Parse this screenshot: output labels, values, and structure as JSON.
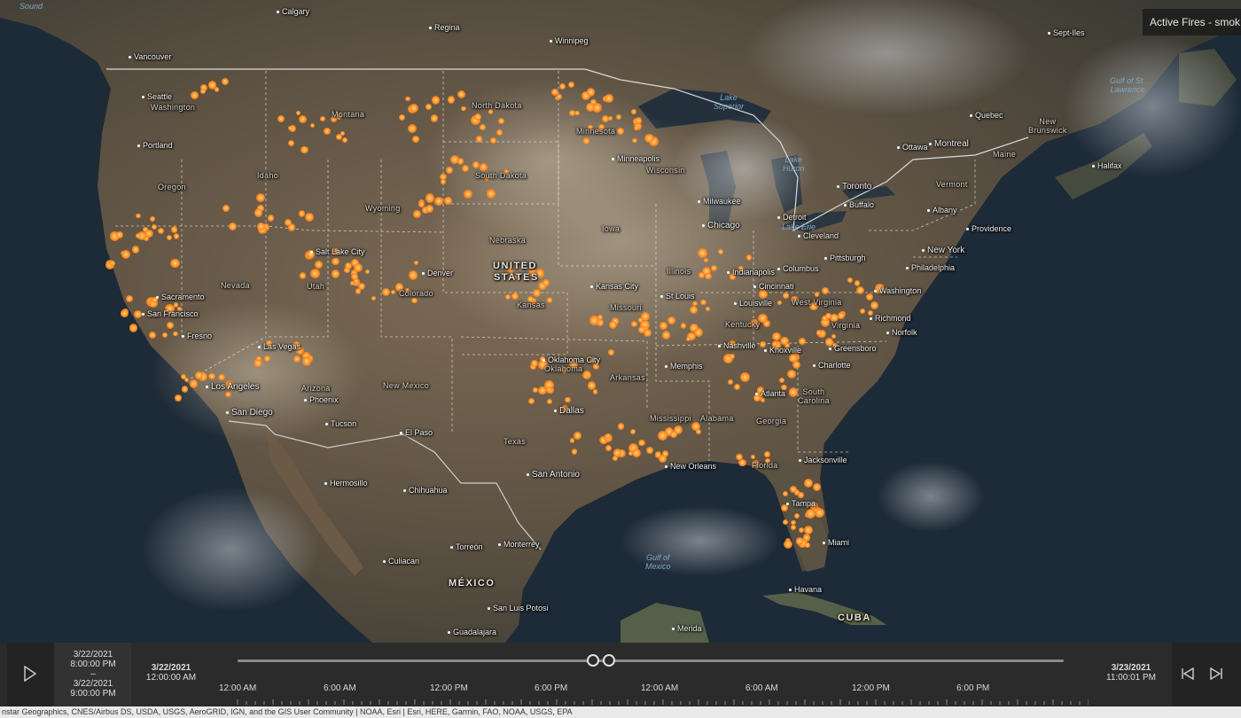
{
  "layer_title": "Active Fires - smok",
  "colors": {
    "fire": "#ff9a2e",
    "panel": "#2b2b2b",
    "ocean": "#1b2632"
  },
  "cities": [
    {
      "name": "Calgary",
      "big": false
    },
    {
      "name": "Regina",
      "big": false
    },
    {
      "name": "Winnipeg",
      "big": false
    },
    {
      "name": "Vancouver",
      "big": false
    },
    {
      "name": "Seattle",
      "big": false
    },
    {
      "name": "Portland",
      "big": false
    },
    {
      "name": "Sacramento",
      "big": false
    },
    {
      "name": "San Francisco",
      "big": false
    },
    {
      "name": "Fresno",
      "big": false
    },
    {
      "name": "Los Angeles",
      "big": true
    },
    {
      "name": "San Diego",
      "big": true
    },
    {
      "name": "Las Vegas",
      "big": false
    },
    {
      "name": "Phoenix",
      "big": false
    },
    {
      "name": "Tucson",
      "big": false
    },
    {
      "name": "Salt Lake City",
      "big": false
    },
    {
      "name": "Denver",
      "big": false
    },
    {
      "name": "El Paso",
      "big": false
    },
    {
      "name": "Hermosillo",
      "big": false
    },
    {
      "name": "Chihuahua",
      "big": false
    },
    {
      "name": "Culiacan",
      "big": false
    },
    {
      "name": "Torreón",
      "big": false
    },
    {
      "name": "Monterrey",
      "big": false
    },
    {
      "name": "San Luis Potosi",
      "big": false
    },
    {
      "name": "Guadalajara",
      "big": false
    },
    {
      "name": "Merida",
      "big": false
    },
    {
      "name": "Havana",
      "big": false
    },
    {
      "name": "Miami",
      "big": false
    },
    {
      "name": "Tampa",
      "big": false
    },
    {
      "name": "Jacksonville",
      "big": false
    },
    {
      "name": "Atlanta",
      "big": false
    },
    {
      "name": "Charlotte",
      "big": false
    },
    {
      "name": "Greensboro",
      "big": false
    },
    {
      "name": "Norfolk",
      "big": false
    },
    {
      "name": "Richmond",
      "big": false
    },
    {
      "name": "Washington",
      "big": false
    },
    {
      "name": "Philadelphia",
      "big": false
    },
    {
      "name": "New York",
      "big": true
    },
    {
      "name": "Providence",
      "big": false
    },
    {
      "name": "Albany",
      "big": false
    },
    {
      "name": "Pittsburgh",
      "big": false
    },
    {
      "name": "Columbus",
      "big": false
    },
    {
      "name": "Cleveland",
      "big": false
    },
    {
      "name": "Detroit",
      "big": false
    },
    {
      "name": "Buffalo",
      "big": false
    },
    {
      "name": "Toronto",
      "big": true
    },
    {
      "name": "Ottawa",
      "big": false
    },
    {
      "name": "Montreal",
      "big": true
    },
    {
      "name": "Quebec",
      "big": false
    },
    {
      "name": "Halifax",
      "big": false
    },
    {
      "name": "Sept-Iles",
      "big": false
    },
    {
      "name": "Chicago",
      "big": true
    },
    {
      "name": "Milwaukee",
      "big": false
    },
    {
      "name": "Minneapolis",
      "big": false
    },
    {
      "name": "Indianapolis",
      "big": false
    },
    {
      "name": "Cincinnati",
      "big": false
    },
    {
      "name": "Louisville",
      "big": false
    },
    {
      "name": "St Louis",
      "big": false
    },
    {
      "name": "Kansas City",
      "big": false
    },
    {
      "name": "Nashville",
      "big": false
    },
    {
      "name": "Knoxville",
      "big": false
    },
    {
      "name": "Memphis",
      "big": false
    },
    {
      "name": "Oklahoma City",
      "big": false
    },
    {
      "name": "Dallas",
      "big": true
    },
    {
      "name": "San Antonio",
      "big": true
    },
    {
      "name": "New Orleans",
      "big": false
    }
  ],
  "regions": [
    "Montana",
    "North Dakota",
    "Minnesota",
    "Wisconsin",
    "South Dakota",
    "Idaho",
    "Oregon",
    "Wyoming",
    "Nebraska",
    "Iowa",
    "Nevada",
    "Utah",
    "Colorado",
    "Kansas",
    "Missouri",
    "Illinois",
    "Kentucky",
    "West Virginia",
    "Virginia",
    "Arizona",
    "New Mexico",
    "Oklahoma",
    "Arkansas",
    "Texas",
    "Mississippi",
    "Alabama",
    "Georgia",
    "South Carolina",
    "Florida",
    "Maine",
    "New Brunswick",
    "Vermont",
    "Washington"
  ],
  "country_labels": [
    "UNITED",
    "STATES",
    "MÉXICO",
    "CUBA"
  ],
  "water_labels": [
    "Sound",
    "Lake Superior",
    "Gulf of St. Lawrence",
    "Lake Huron",
    "Lake Erie",
    "Gulf of Mexico"
  ],
  "time_slider": {
    "play_icon": "play-icon",
    "interval_start_date": "3/22/2021",
    "interval_start_time": "8:00:00 PM",
    "interval_sep": "–",
    "interval_end_date": "3/22/2021",
    "interval_end_time": "9:00:00 PM",
    "start_date": "3/22/2021",
    "start_time": "12:00:00 AM",
    "end_date": "3/23/2021",
    "end_time": "11:00:01 PM",
    "tick_labels": [
      "12:00 AM",
      "6:00 AM",
      "12:00 PM",
      "6:00 PM",
      "12:00 AM",
      "6:00 AM",
      "12:00 PM",
      "6:00 PM"
    ],
    "thumb_start_fraction": 0.43,
    "thumb_end_fraction": 0.45,
    "prev_icon": "step-back-icon",
    "next_icon": "step-forward-icon"
  },
  "attribution": "nstar Geographics, CNES/Airbus DS, USDA, USGS, AeroGRID, IGN, and the GIS User Community | NOAA, Esri | Esri, HERE, Garmin, FAO, NOAA, USGS, EPA"
}
